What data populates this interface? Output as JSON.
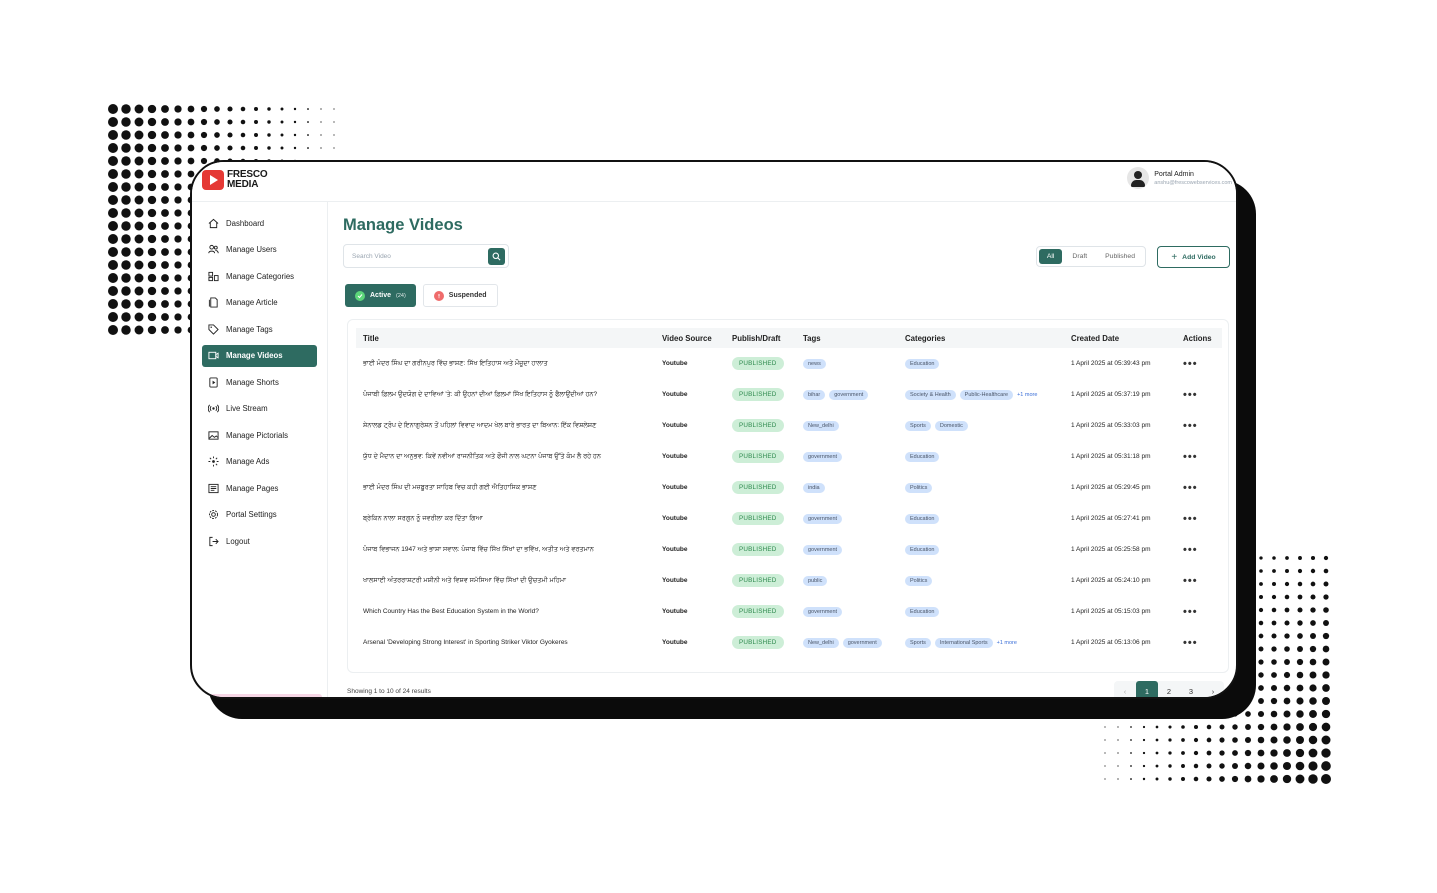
{
  "brand": {
    "line1": "FRESCO",
    "line2": "MEDIA",
    "accent": "#e53935"
  },
  "colors": {
    "primary": "#2e6b61",
    "published_bg": "#cdeed7",
    "tag_bg": "#cfe1fb"
  },
  "profile": {
    "name": "Portal Admin",
    "email": "anshu@frescowebservices.com"
  },
  "sidebar": {
    "items": [
      {
        "label": "Dashboard",
        "icon": "home-icon",
        "active": false
      },
      {
        "label": "Manage Users",
        "icon": "users-icon",
        "active": false
      },
      {
        "label": "Manage Categories",
        "icon": "categories-icon",
        "active": false
      },
      {
        "label": "Manage Article",
        "icon": "article-icon",
        "active": false
      },
      {
        "label": "Manage Tags",
        "icon": "tag-icon",
        "active": false
      },
      {
        "label": "Manage Videos",
        "icon": "video-icon",
        "active": true
      },
      {
        "label": "Manage Shorts",
        "icon": "shorts-icon",
        "active": false
      },
      {
        "label": "Live Stream",
        "icon": "broadcast-icon",
        "active": false
      },
      {
        "label": "Manage Pictorials",
        "icon": "image-icon",
        "active": false
      },
      {
        "label": "Manage Ads",
        "icon": "ads-icon",
        "active": false
      },
      {
        "label": "Manage Pages",
        "icon": "pages-icon",
        "active": false
      },
      {
        "label": "Portal Settings",
        "icon": "gear-icon",
        "active": false
      },
      {
        "label": "Logout",
        "icon": "logout-icon",
        "active": false
      }
    ]
  },
  "main": {
    "title": "Manage Videos",
    "search_placeholder": "Search Video",
    "filters": [
      {
        "label": "All",
        "active": true
      },
      {
        "label": "Draft",
        "active": false
      },
      {
        "label": "Published",
        "active": false
      }
    ],
    "add_label": "Add Video",
    "status_tabs": {
      "active": {
        "label": "Active",
        "count": "(24)"
      },
      "suspended": {
        "label": "Suspended"
      }
    }
  },
  "table": {
    "headers": [
      "Title",
      "Video Source",
      "Publish/Draft",
      "Tags",
      "Categories",
      "Created Date",
      "Actions"
    ],
    "rows": [
      {
        "title": "ਭਾਈ ਮੰਦਰ ਸਿੰਘ ਦਾ ਗਰੀਨਪੁਰ ਵਿੱਚ ਭਾਸ਼ਣ: ਸਿੱਖ ਇਤਿਹਾਸ ਅਤੇ ਮੌਜੂਦਾ ਹਾਲਾਤ",
        "source": "Youtube",
        "status": "PUBLISHED",
        "tags": [
          "news"
        ],
        "categories": [
          "Education"
        ],
        "more": "",
        "date": "1 April 2025 at 05:39:43 pm"
      },
      {
        "title": "ਪੰਜਾਬੀ ਫ਼ਿਲਮ ਉਦਯੋਗ ਦੇ ਦਾਵਿਆਂ 'ਤੇ: ਕੀ ਉਹਨਾਂ ਦੀਆਂ ਫ਼ਿਲਮਾਂ ਸਿੱਖ ਇਤਿਹਾਸ ਨੂੰ ਫੈਲਾਉਂਦੀਆਂ ਹਨ?",
        "source": "Youtube",
        "status": "PUBLISHED",
        "tags": [
          "bihar",
          "government"
        ],
        "categories": [
          "Society & Health",
          "Public-Healthcare"
        ],
        "more": "+1 more",
        "date": "1 April 2025 at 05:37:19 pm"
      },
      {
        "title": "ਸ਼ੇਨਾਲਡ ਟ੍ਰੰਪ ਦੇ ਇਨਾਗੁਰੇਸ਼ਨ ਤੋਂ ਪਹਿਲਾਂ ਵਿਵਾਦ ਆਦਮ ਖੇਲ ਬਾਰੇ ਭਾਰਤ ਦਾ ਬਿਆਨ: ਇੱਕ ਵਿਸ਼ਲੇਸ਼ਣ",
        "source": "Youtube",
        "status": "PUBLISHED",
        "tags": [
          "New_delhi"
        ],
        "categories": [
          "Sports",
          "Domestic"
        ],
        "more": "",
        "date": "1 April 2025 at 05:33:03 pm"
      },
      {
        "title": "ਯੁੱਧ ਦੇ ਮੈਦਾਨ ਦਾ ਅਨੁਭਵ: ਕਿਵੇਂ ਨਵੀਆਂ ਰਾਜਨੀਤਿਕ ਅਤੇ ਫੌਜੀ ਨਾਲ ਘਟਨਾ ਪੰਜਾਬ ਉੱਤੇ ਕੰਮ ਲੈ ਰਹੇ ਹਨ",
        "source": "Youtube",
        "status": "PUBLISHED",
        "tags": [
          "government"
        ],
        "categories": [
          "Education"
        ],
        "more": "",
        "date": "1 April 2025 at 05:31:18 pm"
      },
      {
        "title": "ਭਾਈ ਮੰਦਰ ਸਿੰਘ ਦੀ ਮਜ਼ਬੂਰਤਾ ਸਾਹਿਬ ਵਿਚ ਕਹੀ ਗਈ ਐਤਿਹਾਸਿਕ ਭਾਸ਼ਣ",
        "source": "Youtube",
        "status": "PUBLISHED",
        "tags": [
          "india"
        ],
        "categories": [
          "Politics"
        ],
        "more": "",
        "date": "1 April 2025 at 05:29:45 pm"
      },
      {
        "title": "ਬ੍ਰੇਕਿਨ ਨਾਲਾ ਸਰਗੁਨ ਨੂੰ ਜਵਰੀਲਾ ਕਰ ਦਿੱਤਾ ਗਿਆ",
        "source": "Youtube",
        "status": "PUBLISHED",
        "tags": [
          "government"
        ],
        "categories": [
          "Education"
        ],
        "more": "",
        "date": "1 April 2025 at 05:27:41 pm"
      },
      {
        "title": "ਪੰਜਾਬ ਵਿਭਾਜਨ 1947 ਅਤੇ ਭਾਸ਼ਾ ਸਵਾਲ: ਪੰਜਾਬ ਵਿੱਚ ਸਿੱਖ ਸਿੱਖਾਂ ਦਾ ਭਵਿੱਖ, ਅਤੀਤ ਅਤੇ ਵਰਤਮਾਨ",
        "source": "Youtube",
        "status": "PUBLISHED",
        "tags": [
          "government"
        ],
        "categories": [
          "Education"
        ],
        "more": "",
        "date": "1 April 2025 at 05:25:58 pm"
      },
      {
        "title": "ਖਾਲਸਾਈ ਅੰਤਰਰਾਸ਼ਟਰੀ ਮਸ਼ੀਨੀ ਅਤੇ ਵਿਸ਼ਵ ਸਮੱਸਿਆ ਵਿੱਚ ਸਿੱਖਾਂ ਦੀ ਉਚਤਮੀ ਮਹਿਮਾ",
        "source": "Youtube",
        "status": "PUBLISHED",
        "tags": [
          "public"
        ],
        "categories": [
          "Politics"
        ],
        "more": "",
        "date": "1 April 2025 at 05:24:10 pm"
      },
      {
        "title": "Which Country Has the Best Education System in the World?",
        "source": "Youtube",
        "status": "PUBLISHED",
        "tags": [
          "government"
        ],
        "categories": [
          "Education"
        ],
        "more": "",
        "date": "1 April 2025 at 05:15:03 pm"
      },
      {
        "title": "Arsenal 'Developing Strong Interest' in Sporting Striker Viktor Gyokeres",
        "source": "Youtube",
        "status": "PUBLISHED",
        "tags": [
          "New_delhi",
          "government"
        ],
        "categories": [
          "Sports",
          "International Sports"
        ],
        "more": "+1 more",
        "date": "1 April 2025 at 05:13:06 pm"
      }
    ]
  },
  "footer": {
    "showing": "Showing 1 to 10 of 24 results"
  },
  "pagination": {
    "prev": "‹",
    "pages": [
      "1",
      "2",
      "3"
    ],
    "current": "1",
    "next": "›"
  }
}
